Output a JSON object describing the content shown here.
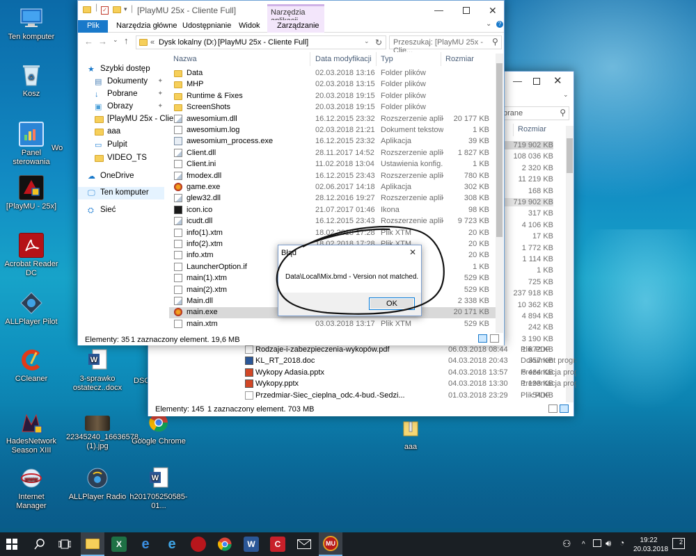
{
  "desktop": {
    "icons": [
      {
        "label": "Ten komputer"
      },
      {
        "label": "Kosz"
      },
      {
        "label": "Panel sterowania"
      },
      {
        "label": "Wo"
      },
      {
        "label": "[PlayMU - 25x]"
      },
      {
        "label": "Acrobat Reader DC"
      },
      {
        "label": "ALLPlayer Pilot"
      },
      {
        "label": "CCleaner"
      },
      {
        "label": "3-sprawko ostatecz..docx"
      },
      {
        "label": "DSC"
      },
      {
        "label": "HadesNetwork Season XIII"
      },
      {
        "label": "22345240_16636578... (1).jpg"
      },
      {
        "label": "Google Chrome"
      },
      {
        "label": "aaa"
      },
      {
        "label": "Internet Manager"
      },
      {
        "label": "ALLPlayer Radio"
      },
      {
        "label": "h201705250585-01..."
      }
    ]
  },
  "back_window": {
    "search_placeholder": "brane",
    "header_size": "Rozmiar",
    "sizes": [
      "719 902 KB",
      "108 036 KB",
      "2 320 KB",
      "11 219 KB",
      "168 KB",
      "719 902 KB",
      "317 KB",
      "4 106 KB",
      "17 KB",
      "1 772 KB",
      "1 114 KB",
      "1 KB",
      "725 KB",
      "237 918 KB",
      "10 362 KB",
      "4 894 KB",
      "242 KB",
      "3 190 KB"
    ],
    "rows": [
      {
        "name": "Rodzaje-i-zabezpieczenia-wykopów.pdf",
        "date": "06.03.2018 08:44",
        "type": "Plik PDF",
        "size": "1 672 KB"
      },
      {
        "name": "KL_RT_2018.doc",
        "date": "04.03.2018 20:43",
        "type": "Dokument progra...",
        "size": "357 KB"
      },
      {
        "name": "Wykopy Adasia.pptx",
        "date": "04.03.2018 13:57",
        "type": "Prezentacja progr...",
        "size": "5 464 KB"
      },
      {
        "name": "Wykopy.pptx",
        "date": "04.03.2018 13:30",
        "type": "Prezentacja progr...",
        "size": "1 193 KB"
      },
      {
        "name": "Przedmiar-Siec_cieplna_odc.4-bud.-Sedzi...",
        "date": "01.03.2018 23:29",
        "type": "Plik PDF",
        "size": "54 KB"
      }
    ],
    "status_count": "Elementy: 145",
    "status_selected": "1 zaznaczony element. 703 MB"
  },
  "front_window": {
    "title": "[PlayMU 25x - Cliente Full]",
    "ribbon_context": "Narzędzia aplikacji",
    "tabs": [
      "Plik",
      "Narzędzia główne",
      "Udostępnianie",
      "Widok",
      "Zarządzanie"
    ],
    "path": [
      "Dysk lokalny (D:)",
      "[PlayMU 25x - Cliente Full]"
    ],
    "path_prefix": "«",
    "search_placeholder": "Przeszukaj: [PlayMU 25x - Clie...",
    "columns": [
      "Nazwa",
      "Data modyfikacji",
      "Typ",
      "Rozmiar"
    ],
    "nav": [
      {
        "label": "Szybki dostęp"
      },
      {
        "label": "Dokumenty",
        "pinned": true
      },
      {
        "label": "Pobrane",
        "pinned": true
      },
      {
        "label": "Obrazy",
        "pinned": true
      },
      {
        "label": "[PlayMU 25x - Clien"
      },
      {
        "label": "aaa"
      },
      {
        "label": "Pulpit"
      },
      {
        "label": "VIDEO_TS"
      },
      {
        "label": "OneDrive"
      },
      {
        "label": "Ten komputer"
      },
      {
        "label": "Sieć"
      }
    ],
    "files": [
      {
        "name": "Data",
        "date": "02.03.2018 13:16",
        "type": "Folder plików",
        "size": "",
        "kind": "folder"
      },
      {
        "name": "MHP",
        "date": "02.03.2018 13:15",
        "type": "Folder plików",
        "size": "",
        "kind": "folder"
      },
      {
        "name": "Runtime & Fixes",
        "date": "20.03.2018 19:15",
        "type": "Folder plików",
        "size": "",
        "kind": "folder"
      },
      {
        "name": "ScreenShots",
        "date": "20.03.2018 19:15",
        "type": "Folder plików",
        "size": "",
        "kind": "folder"
      },
      {
        "name": "awesomium.dll",
        "date": "16.12.2015 23:32",
        "type": "Rozszerzenie aplik...",
        "size": "20 177 KB",
        "kind": "dll"
      },
      {
        "name": "awesomium.log",
        "date": "02.03.2018 21:21",
        "type": "Dokument tekstowy",
        "size": "1 KB",
        "kind": "doc"
      },
      {
        "name": "awesomium_process.exe",
        "date": "16.12.2015 23:32",
        "type": "Aplikacja",
        "size": "39 KB",
        "kind": "exe"
      },
      {
        "name": "Client.dll",
        "date": "28.11.2017 14:52",
        "type": "Rozszerzenie aplik...",
        "size": "1 827 KB",
        "kind": "dll"
      },
      {
        "name": "Client.ini",
        "date": "11.02.2018 13:04",
        "type": "Ustawienia konfig...",
        "size": "1 KB",
        "kind": "doc"
      },
      {
        "name": "fmodex.dll",
        "date": "16.12.2015 23:43",
        "type": "Rozszerzenie aplik...",
        "size": "780 KB",
        "kind": "dll"
      },
      {
        "name": "game.exe",
        "date": "02.06.2017 14:18",
        "type": "Aplikacja",
        "size": "302 KB",
        "kind": "game"
      },
      {
        "name": "glew32.dll",
        "date": "28.12.2016 19:27",
        "type": "Rozszerzenie aplik...",
        "size": "308 KB",
        "kind": "dll"
      },
      {
        "name": "icon.ico",
        "date": "21.07.2017 01:46",
        "type": "Ikona",
        "size": "98 KB",
        "kind": "ico"
      },
      {
        "name": "icudt.dll",
        "date": "16.12.2015 23:43",
        "type": "Rozszerzenie aplik...",
        "size": "9 723 KB",
        "kind": "dll"
      },
      {
        "name": "info(1).xtm",
        "date": "18.02.2018 17:28",
        "type": "Plik XTM",
        "size": "20 KB",
        "kind": "doc"
      },
      {
        "name": "info(2).xtm",
        "date": "18.02.2018 17:28",
        "type": "Plik XTM",
        "size": "20 KB",
        "kind": "doc"
      },
      {
        "name": "info.xtm",
        "date": "",
        "type": "",
        "size": "20 KB",
        "kind": "doc"
      },
      {
        "name": "LauncherOption.if",
        "date": "",
        "type": "",
        "size": "1 KB",
        "kind": "doc"
      },
      {
        "name": "main(1).xtm",
        "date": "",
        "type": "",
        "size": "529 KB",
        "kind": "doc"
      },
      {
        "name": "main(2).xtm",
        "date": "",
        "type": "",
        "size": "529 KB",
        "kind": "doc"
      },
      {
        "name": "Main.dll",
        "date": "",
        "type": "plik",
        "size": "2 338 KB",
        "kind": "dll"
      },
      {
        "name": "main.exe",
        "date": "",
        "type": "",
        "size": "20 171 KB",
        "kind": "game",
        "selected": true
      },
      {
        "name": "main.xtm",
        "date": "03.03.2018 13:17",
        "type": "Plik XTM",
        "size": "529 KB",
        "kind": "doc"
      }
    ],
    "status_count": "Elementy: 35",
    "status_selected": "1 zaznaczony element. 19,6 MB"
  },
  "dialog": {
    "title": "Błąd",
    "message": "Data\\Local\\Mix.bmd - Version not matched.",
    "ok_label": "OK"
  },
  "taskbar": {
    "time": "19:22",
    "date": "20.03.2018",
    "notifications": "2"
  },
  "colors": {
    "accent": "#1979ca",
    "context_tab": "#e8d4f5",
    "selection": "#cce8ff"
  }
}
